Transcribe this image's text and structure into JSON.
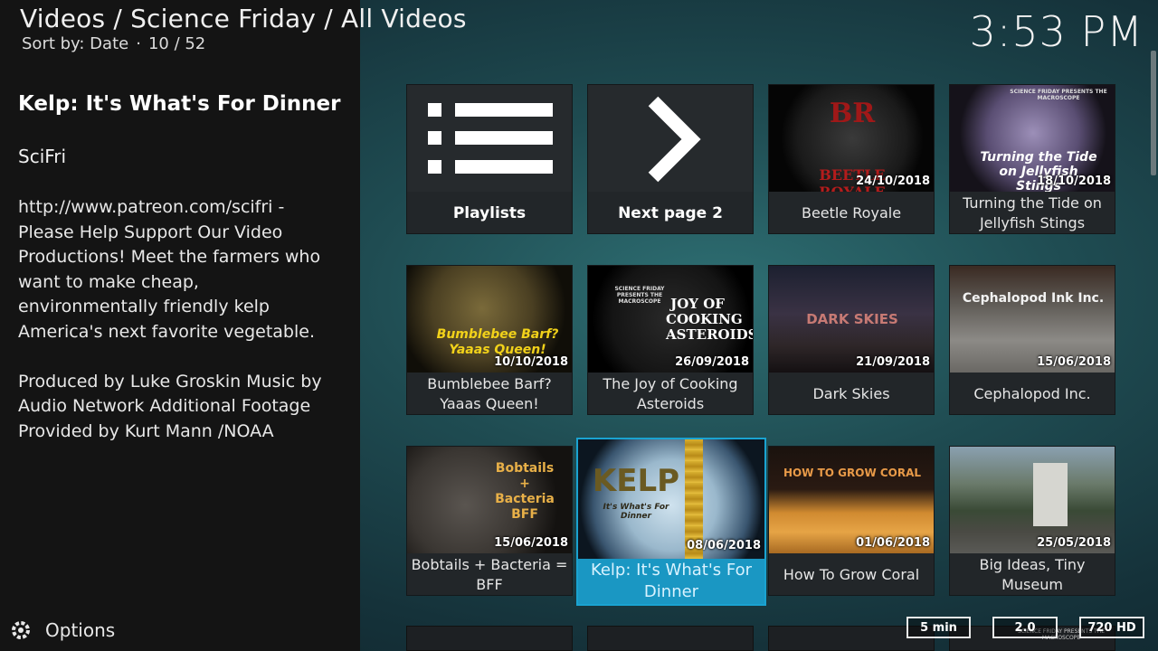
{
  "header": {
    "breadcrumb": "Videos / Science Friday / All Videos",
    "sort_label": "Sort by: Date",
    "position": "10 / 52",
    "clock": "3:53 PM"
  },
  "info": {
    "title": "Kelp: It's What's For Dinner",
    "studio": "SciFri",
    "plot_paragraphs": [
      "http://www.patreon.com/scifri - Please Help Support Our Video Productions! Meet the farmers who want to make cheap, environmentally friendly kelp America's next favorite vegetable.",
      "Produced by Luke Groskin Music by Audio Network Additional Footage Provided by Kurt Mann /NOAA"
    ]
  },
  "tiles": [
    {
      "label": "Playlists",
      "date": "",
      "icon": "list-icon"
    },
    {
      "label": "Next page 2",
      "date": "",
      "icon": "chevron-right-icon"
    },
    {
      "label": "Beetle Royale",
      "date": "24/10/2018",
      "thumb_text": "BEETLE ROYALE",
      "thumb_text2": "BR"
    },
    {
      "label": "Turning the Tide on Jellyfish Stings",
      "date": "18/10/2018",
      "thumb_text": "Turning the Tide on Jellyfish Stings",
      "thumb_text2": "SCIENCE FRIDAY PRESENTS THE MACROSCOPE"
    },
    {
      "label": "Bumblebee Barf? Yaaas Queen!",
      "date": "10/10/2018",
      "thumb_text": "Bumblebee Barf? Yaaas Queen!"
    },
    {
      "label": "The Joy of Cooking Asteroids",
      "date": "26/09/2018",
      "thumb_text": "JOY OF COOKING ASTEROIDS",
      "thumb_text2": "SCIENCE FRIDAY PRESENTS THE MACROSCOPE"
    },
    {
      "label": "Dark Skies",
      "date": "21/09/2018",
      "thumb_text": "DARK SKIES"
    },
    {
      "label": "Cephalopod Inc.",
      "date": "15/06/2018",
      "thumb_text": "Cephalopod Ink Inc."
    },
    {
      "label": "Bobtails + Bacteria = BFF",
      "date": "15/06/2018",
      "thumb_text": "Bobtails + Bacteria BFF"
    },
    {
      "label": "Kelp: It's What's For Dinner",
      "date": "08/06/2018",
      "thumb_text": "KELP",
      "thumb_text2": "It's What's For Dinner"
    },
    {
      "label": "How To Grow Coral",
      "date": "01/06/2018",
      "thumb_text": "HOW TO GROW CORAL"
    },
    {
      "label": "Big Ideas, Tiny Museum",
      "date": "25/05/2018"
    }
  ],
  "footer": {
    "options_label": "Options",
    "badges": [
      "5 min",
      "2.0",
      "720 HD"
    ],
    "partial_text": "SCIENCE FRIDAY PRESENTS THE MACROSCOPE"
  },
  "colors": {
    "focus": "#1a97c3",
    "panel": "#141414",
    "background": "#1f4c52"
  }
}
